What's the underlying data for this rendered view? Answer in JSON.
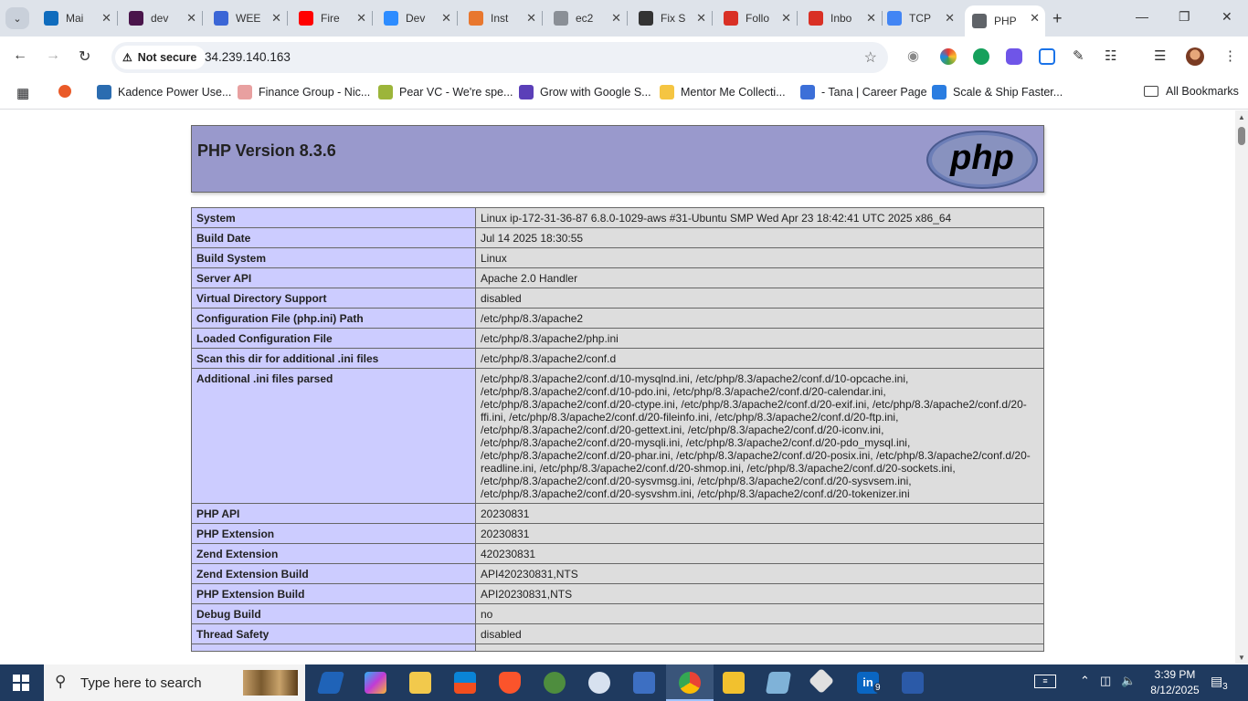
{
  "browser": {
    "tabs": [
      {
        "label": "Mai",
        "icon": "outlook-icon",
        "color": "#0f6cbd"
      },
      {
        "label": "dev",
        "icon": "slack-icon",
        "color": "#4a154b"
      },
      {
        "label": "WEE",
        "icon": "network-icon",
        "color": "#3b66d6"
      },
      {
        "label": "Fire",
        "icon": "youtube-icon",
        "color": "#ff0000"
      },
      {
        "label": "Dev",
        "icon": "zoom-icon",
        "color": "#2d8cff"
      },
      {
        "label": "Inst",
        "icon": "aws-icon",
        "color": "#e8772e"
      },
      {
        "label": "ec2",
        "icon": "globe-icon",
        "color": "#8a8f96"
      },
      {
        "label": "Fix S",
        "icon": "openai-icon",
        "color": "#333333"
      },
      {
        "label": "Follo",
        "icon": "gmail-icon",
        "color": "#d93025"
      },
      {
        "label": "Inbo",
        "icon": "gmail-icon",
        "color": "#d93025"
      },
      {
        "label": "TCP",
        "icon": "docs-icon",
        "color": "#4285f4"
      },
      {
        "label": "PHP",
        "icon": "globe-icon",
        "color": "#5f6368"
      }
    ],
    "security_label": "Not secure",
    "url": "34.239.140.163",
    "bookmarks": [
      {
        "label": "Kadence Power Use...",
        "color": "#2b6cb0"
      },
      {
        "label": "Finance Group - Nic...",
        "color": "#e8a0a0"
      },
      {
        "label": "Pear VC - We're spe...",
        "color": "#9cb53a"
      },
      {
        "label": "Grow with Google S...",
        "color": "#5b3fb8"
      },
      {
        "label": "Mentor Me Collecti...",
        "color": "#f5c542"
      },
      {
        "label": "- Tana | Career Page",
        "color": "#3c6fd8"
      },
      {
        "label": "Scale & Ship Faster...",
        "color": "#2a7de1"
      }
    ],
    "all_bookmarks_label": "All Bookmarks"
  },
  "page": {
    "title": "PHP Version 8.3.6",
    "logo_text": "php",
    "rows": [
      {
        "key": "System",
        "value": "Linux ip-172-31-36-87 6.8.0-1029-aws #31-Ubuntu SMP Wed Apr 23 18:42:41 UTC 2025 x86_64"
      },
      {
        "key": "Build Date",
        "value": "Jul 14 2025 18:30:55"
      },
      {
        "key": "Build System",
        "value": "Linux"
      },
      {
        "key": "Server API",
        "value": "Apache 2.0 Handler"
      },
      {
        "key": "Virtual Directory Support",
        "value": "disabled"
      },
      {
        "key": "Configuration File (php.ini) Path",
        "value": "/etc/php/8.3/apache2"
      },
      {
        "key": "Loaded Configuration File",
        "value": "/etc/php/8.3/apache2/php.ini"
      },
      {
        "key": "Scan this dir for additional .ini files",
        "value": "/etc/php/8.3/apache2/conf.d"
      },
      {
        "key": "Additional .ini files parsed",
        "value": "/etc/php/8.3/apache2/conf.d/10-mysqlnd.ini, /etc/php/8.3/apache2/conf.d/10-opcache.ini, /etc/php/8.3/apache2/conf.d/10-pdo.ini, /etc/php/8.3/apache2/conf.d/20-calendar.ini, /etc/php/8.3/apache2/conf.d/20-ctype.ini, /etc/php/8.3/apache2/conf.d/20-exif.ini, /etc/php/8.3/apache2/conf.d/20-ffi.ini, /etc/php/8.3/apache2/conf.d/20-fileinfo.ini, /etc/php/8.3/apache2/conf.d/20-ftp.ini, /etc/php/8.3/apache2/conf.d/20-gettext.ini, /etc/php/8.3/apache2/conf.d/20-iconv.ini, /etc/php/8.3/apache2/conf.d/20-mysqli.ini, /etc/php/8.3/apache2/conf.d/20-pdo_mysql.ini, /etc/php/8.3/apache2/conf.d/20-phar.ini, /etc/php/8.3/apache2/conf.d/20-posix.ini, /etc/php/8.3/apache2/conf.d/20-readline.ini, /etc/php/8.3/apache2/conf.d/20-shmop.ini, /etc/php/8.3/apache2/conf.d/20-sockets.ini, /etc/php/8.3/apache2/conf.d/20-sysvmsg.ini, /etc/php/8.3/apache2/conf.d/20-sysvsem.ini, /etc/php/8.3/apache2/conf.d/20-sysvshm.ini, /etc/php/8.3/apache2/conf.d/20-tokenizer.ini"
      },
      {
        "key": "PHP API",
        "value": "20230831"
      },
      {
        "key": "PHP Extension",
        "value": "20230831"
      },
      {
        "key": "Zend Extension",
        "value": "420230831"
      },
      {
        "key": "Zend Extension Build",
        "value": "API420230831,NTS"
      },
      {
        "key": "PHP Extension Build",
        "value": "API20230831,NTS"
      },
      {
        "key": "Debug Build",
        "value": "no"
      },
      {
        "key": "Thread Safety",
        "value": "disabled"
      },
      {
        "key": "",
        "value": ""
      }
    ]
  },
  "taskbar": {
    "search_placeholder": "Type here to search",
    "time": "3:39 PM",
    "date": "8/12/2025",
    "notification_count": "3",
    "linkedin_badge": "9"
  }
}
